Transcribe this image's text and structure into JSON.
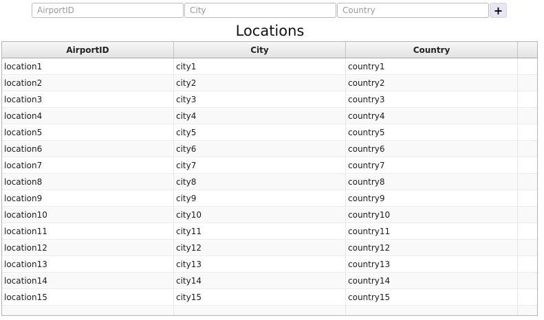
{
  "inputs": {
    "airport_placeholder": "AirportID",
    "city_placeholder": "City",
    "country_placeholder": "Country",
    "airport_value": "",
    "city_value": "",
    "country_value": ""
  },
  "add_button": {
    "label": "+"
  },
  "title": "Locations",
  "table": {
    "columns": [
      "AirportID",
      "City",
      "Country"
    ],
    "rows": [
      [
        "location1",
        "city1",
        "country1"
      ],
      [
        "location2",
        "city2",
        "country2"
      ],
      [
        "location3",
        "city3",
        "country3"
      ],
      [
        "location4",
        "city4",
        "country4"
      ],
      [
        "location5",
        "city5",
        "country5"
      ],
      [
        "location6",
        "city6",
        "country6"
      ],
      [
        "location7",
        "city7",
        "country7"
      ],
      [
        "location8",
        "city8",
        "country8"
      ],
      [
        "location9",
        "city9",
        "country9"
      ],
      [
        "location10",
        "city10",
        "country10"
      ],
      [
        "location11",
        "city11",
        "country11"
      ],
      [
        "location12",
        "city12",
        "country12"
      ],
      [
        "location13",
        "city13",
        "country13"
      ],
      [
        "location14",
        "city14",
        "country14"
      ],
      [
        "location15",
        "city15",
        "country15"
      ]
    ]
  },
  "colors": {
    "button_bg": "#e8e6f3",
    "header_bg": "#e9e9e9",
    "border": "#b3b3b3"
  }
}
